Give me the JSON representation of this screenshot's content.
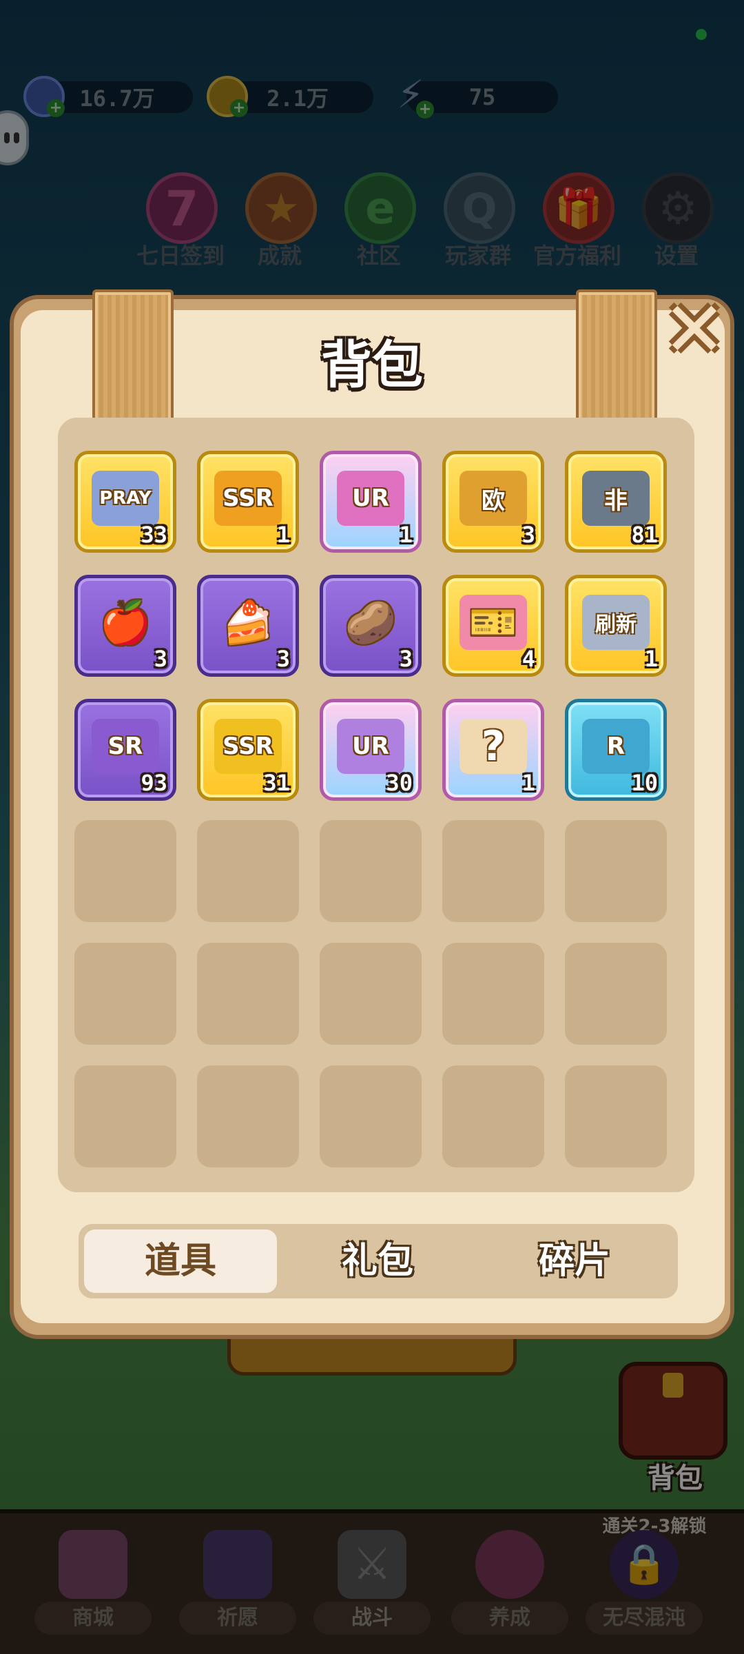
{
  "status": {
    "dot_color": "#27c24c"
  },
  "resources": [
    {
      "icon": "gem-plus-icon",
      "value": "16.7万"
    },
    {
      "icon": "coin-plus-icon",
      "value": "2.1万"
    },
    {
      "icon": "energy-plus-icon",
      "value": "75"
    }
  ],
  "menu": [
    {
      "label": "七日签到",
      "glyph": "7"
    },
    {
      "label": "成就",
      "glyph": "★"
    },
    {
      "label": "社区",
      "glyph": "e"
    },
    {
      "label": "玩家群",
      "glyph": "Q"
    },
    {
      "label": "官方福利",
      "glyph": "🎁"
    },
    {
      "label": "设置",
      "glyph": "⚙"
    }
  ],
  "panel": {
    "title": "背包",
    "close_label": "✕"
  },
  "items": [
    {
      "art": "PRAY",
      "count": "33",
      "style": "gold"
    },
    {
      "art": "SSR",
      "count": "1",
      "style": "gold"
    },
    {
      "art": "UR",
      "count": "1",
      "style": "pink"
    },
    {
      "art": "欧",
      "count": "3",
      "style": "gold"
    },
    {
      "art": "非",
      "count": "81",
      "style": "gold"
    },
    {
      "art": "🍎",
      "count": "3",
      "style": "purple"
    },
    {
      "art": "🍰",
      "count": "3",
      "style": "purple"
    },
    {
      "art": "🥔",
      "count": "3",
      "style": "purple"
    },
    {
      "art": "🎫",
      "count": "4",
      "style": "gold"
    },
    {
      "art": "刷新",
      "count": "1",
      "style": "gold"
    },
    {
      "art": "SR",
      "count": "93",
      "style": "purple"
    },
    {
      "art": "SSR",
      "count": "31",
      "style": "gold"
    },
    {
      "art": "UR",
      "count": "30",
      "style": "pink"
    },
    {
      "art": "?",
      "count": "1",
      "style": "pink"
    },
    {
      "art": "R",
      "count": "10",
      "style": "blue"
    }
  ],
  "tabs": [
    {
      "label": "道具",
      "active": true
    },
    {
      "label": "礼包",
      "active": false
    },
    {
      "label": "碎片",
      "active": false
    }
  ],
  "backpack_shortcut": {
    "label": "背包"
  },
  "unlock_hint": "通关2-3解锁",
  "nav": [
    {
      "label": "商城",
      "icon": "shop-icon"
    },
    {
      "label": "祈愿",
      "icon": "wish-card-icon"
    },
    {
      "label": "战斗",
      "icon": "crossed-swords-icon"
    },
    {
      "label": "养成",
      "icon": "paw-icon"
    },
    {
      "label": "无尽混沌",
      "icon": "lock-icon"
    }
  ]
}
